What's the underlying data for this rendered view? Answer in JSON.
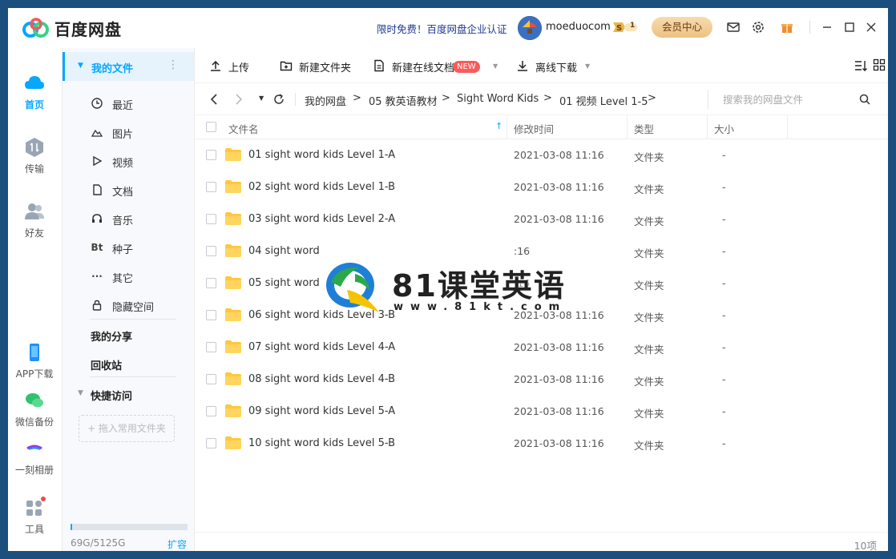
{
  "app": {
    "title": "百度网盘"
  },
  "header": {
    "promo": "限时免费！百度网盘企业认证",
    "username": "moeduocom",
    "svip_level": "1",
    "vip_button": "会员中心"
  },
  "leftnav": {
    "items": [
      {
        "label": "首页",
        "icon": "cloud-icon",
        "active": true
      },
      {
        "label": "传输",
        "icon": "transfer-icon"
      },
      {
        "label": "好友",
        "icon": "friends-icon"
      },
      {
        "label": "APP下载",
        "icon": "phone-icon"
      },
      {
        "label": "微信备份",
        "icon": "wechat-icon"
      },
      {
        "label": "一刻相册",
        "icon": "album-icon"
      },
      {
        "label": "工具",
        "icon": "tools-icon"
      }
    ]
  },
  "sidebar": {
    "my_files": "我的文件",
    "items": [
      {
        "label": "最近",
        "icon": "clock-icon"
      },
      {
        "label": "图片",
        "icon": "image-icon"
      },
      {
        "label": "视频",
        "icon": "play-icon"
      },
      {
        "label": "文档",
        "icon": "document-icon"
      },
      {
        "label": "音乐",
        "icon": "headphones-icon"
      },
      {
        "label": "种子",
        "icon": "bt-icon",
        "glyph": "Bt"
      },
      {
        "label": "其它",
        "icon": "more-icon",
        "glyph": "···"
      },
      {
        "label": "隐藏空间",
        "icon": "lock-icon"
      }
    ],
    "my_share": "我的分享",
    "recycle": "回收站",
    "quick_access": "快捷访问",
    "drop_hint": "+ 拖入常用文件夹",
    "quota": "69G/5125G",
    "quota_fraction": 0.0135,
    "expand": "扩容"
  },
  "toolbar": {
    "upload": "上传",
    "new_folder": "新建文件夹",
    "new_doc": "新建在线文档",
    "new_badge": "NEW",
    "offline": "离线下载"
  },
  "breadcrumb": {
    "items": [
      "我的网盘",
      "05 教英语教材",
      "Sight Word Kids",
      "01 视频 Level 1-5"
    ],
    "separator": ">"
  },
  "search": {
    "placeholder": "搜索我的网盘文件"
  },
  "table": {
    "columns": {
      "name": "文件名",
      "time": "修改时间",
      "type": "类型",
      "size": "大小"
    },
    "rows": [
      {
        "name": "01 sight word kids Level 1-A",
        "time": "2021-03-08 11:16",
        "type": "文件夹",
        "size": "-"
      },
      {
        "name": "02 sight word kids Level 1-B",
        "time": "2021-03-08 11:16",
        "type": "文件夹",
        "size": "-"
      },
      {
        "name": "03 sight word kids Level 2-A",
        "time": "2021-03-08 11:16",
        "type": "文件夹",
        "size": "-"
      },
      {
        "name": "04 sight word",
        "time": ":16",
        "type": "文件夹",
        "size": "-"
      },
      {
        "name": "05 sight word",
        "time": ":16",
        "type": "文件夹",
        "size": "-"
      },
      {
        "name": "06 sight word kids Level 3-B",
        "time": "2021-03-08 11:16",
        "type": "文件夹",
        "size": "-"
      },
      {
        "name": "07 sight word kids Level 4-A",
        "time": "2021-03-08 11:16",
        "type": "文件夹",
        "size": "-"
      },
      {
        "name": "08 sight word kids Level 4-B",
        "time": "2021-03-08 11:16",
        "type": "文件夹",
        "size": "-"
      },
      {
        "name": "09 sight word kids Level 5-A",
        "time": "2021-03-08 11:16",
        "type": "文件夹",
        "size": "-"
      },
      {
        "name": "10 sight word kids Level 5-B",
        "time": "2021-03-08 11:16",
        "type": "文件夹",
        "size": "-"
      }
    ]
  },
  "footer": {
    "count": "10项"
  },
  "watermark": {
    "title": "81课堂英语",
    "url": "www.81kt.com"
  },
  "colors": {
    "accent": "#06a7ff",
    "folder": "#ffc83d",
    "badge": "#fa5a5a",
    "vip": "#ecc283"
  }
}
